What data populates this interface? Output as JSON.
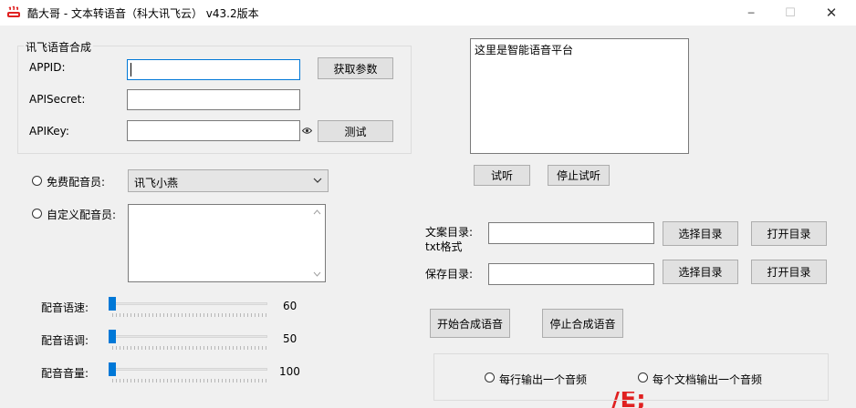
{
  "window": {
    "title": "酷大哥 -  文本转语音（科大讯飞云）  v43.2版本",
    "minimize": "─",
    "maximize": "☐",
    "close": "✕"
  },
  "group": {
    "label": "讯飞语音合成",
    "appid_label": "APPID:",
    "appid_value": "",
    "apisecret_label": "APISecret:",
    "apisecret_value": "",
    "apikey_label": "APIKey:",
    "apikey_value": "",
    "get_params_button": "获取参数",
    "test_button": "测试"
  },
  "preview": {
    "text": "这里是智能语音平台",
    "listen_button": "试听",
    "stop_listen_button": "停止试听"
  },
  "voice": {
    "free_label": "免费配音员:",
    "free_selected": "讯飞小燕",
    "custom_label": "自定义配音员:",
    "custom_value": ""
  },
  "sliders": {
    "speed_label": "配音语速:",
    "speed_value": "60",
    "pitch_label": "配音语调:",
    "pitch_value": "50",
    "volume_label": "配音音量:",
    "volume_value": "100"
  },
  "dirs": {
    "text_dir_label": "文案目录:",
    "text_dir_sub": "txt格式",
    "text_dir_value": "",
    "save_dir_label": "保存目录:",
    "save_dir_value": "",
    "choose_button": "选择目录",
    "open_button": "打开目录"
  },
  "actions": {
    "start_button": "开始合成语音",
    "stop_button": "停止合成语音"
  },
  "output_mode": {
    "per_line": "每行输出一个音频",
    "per_doc": "每个文档输出一个音频"
  },
  "background_fragment": "/E; ",
  "colors": {
    "accent": "#0078d7",
    "brand_red": "#e02020"
  }
}
